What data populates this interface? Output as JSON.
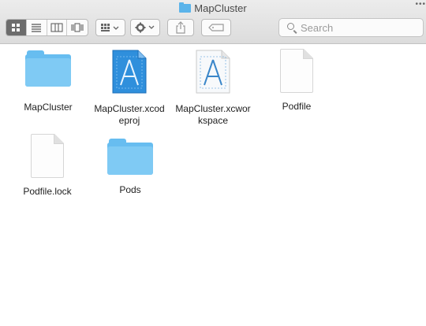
{
  "window": {
    "title": "MapCluster",
    "overflow_dots": "•••"
  },
  "toolbar": {
    "view_buttons": [
      "icon-view",
      "list-view",
      "column-view",
      "cover-flow-view"
    ],
    "arrange_icon": "arrange-grid-icon",
    "action_icon": "gear-icon",
    "share_icon": "share-icon",
    "tag_icon": "tag-icon"
  },
  "search": {
    "placeholder": "Search"
  },
  "files": [
    {
      "name": "MapCluster",
      "kind": "folder"
    },
    {
      "name": "MapCluster.xcodeproj",
      "kind": "xcodeproj"
    },
    {
      "name": "MapCluster.xcworkspace",
      "kind": "xcworkspace"
    },
    {
      "name": "Podfile",
      "kind": "document"
    },
    {
      "name": "Podfile.lock",
      "kind": "document"
    },
    {
      "name": "Pods",
      "kind": "folder"
    }
  ],
  "colors": {
    "folder": "#7fcaf4",
    "xcode_blue": "#2c8fe0",
    "active_segment": "#6c6c6c"
  }
}
